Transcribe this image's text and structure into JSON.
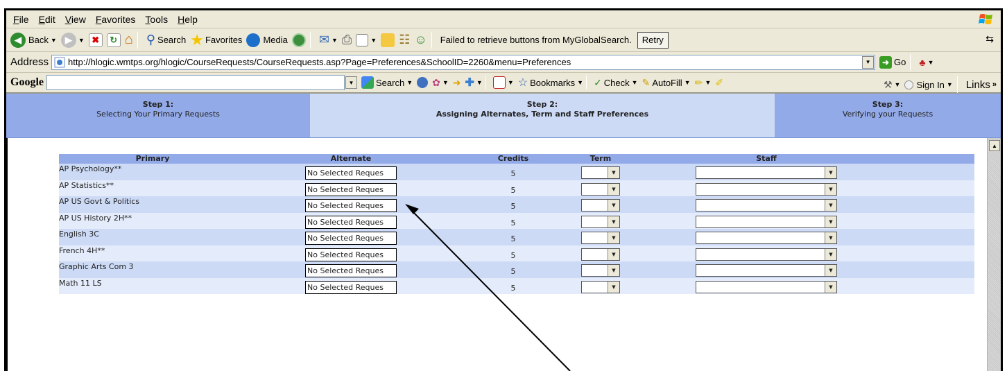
{
  "menu": [
    "File",
    "Edit",
    "View",
    "Favorites",
    "Tools",
    "Help"
  ],
  "toolbar": {
    "back_label": "Back",
    "search_label": "Search",
    "favorites_label": "Favorites",
    "media_label": "Media",
    "status_text": "Failed to retrieve buttons from MyGlobalSearch.",
    "retry_label": "Retry"
  },
  "address": {
    "label": "Address",
    "url": "http://hlogic.wmtps.org/hlogic/CourseRequests/CourseRequests.asp?Page=Preferences&SchoolID=2260&menu=Preferences",
    "go_label": "Go",
    "links_label": "Links"
  },
  "google": {
    "logo": "Google",
    "search_label": "Search",
    "bookmarks_label": "Bookmarks",
    "check_label": "Check",
    "autofill_label": "AutoFill",
    "signin_label": "Sign In"
  },
  "steps": [
    {
      "title": "Step 1:",
      "desc": "Selecting Your Primary Requests"
    },
    {
      "title": "Step 2:",
      "desc": "Assigning Alternates, Term and Staff Preferences"
    },
    {
      "title": "Step 3:",
      "desc": "Verifying your Requests"
    }
  ],
  "grid": {
    "headers": {
      "primary": "Primary",
      "alternate": "Alternate",
      "credits": "Credits",
      "term": "Term",
      "staff": "Staff"
    },
    "rows": [
      {
        "primary": "AP Psychology**",
        "alternate": "No Selected Reques",
        "credits": "5"
      },
      {
        "primary": "AP Statistics**",
        "alternate": "No Selected Reques",
        "credits": "5"
      },
      {
        "primary": "AP US Govt & Politics",
        "alternate": "No Selected Reques",
        "credits": "5"
      },
      {
        "primary": "AP US History 2H**",
        "alternate": "No Selected Reques",
        "credits": "5"
      },
      {
        "primary": "English 3C",
        "alternate": "No Selected Reques",
        "credits": "5"
      },
      {
        "primary": "French 4H**",
        "alternate": "No Selected Reques",
        "credits": "5"
      },
      {
        "primary": "Graphic Arts Com 3",
        "alternate": "No Selected Reques",
        "credits": "5"
      },
      {
        "primary": "Math 11 LS",
        "alternate": "No Selected Reques",
        "credits": "5"
      }
    ]
  },
  "colors": {
    "step_active": "#ccdaf6",
    "step_inactive": "#93aae8",
    "row_odd": "#ccdaf6",
    "row_even": "#e4ecfb",
    "chrome": "#ece9d8"
  }
}
